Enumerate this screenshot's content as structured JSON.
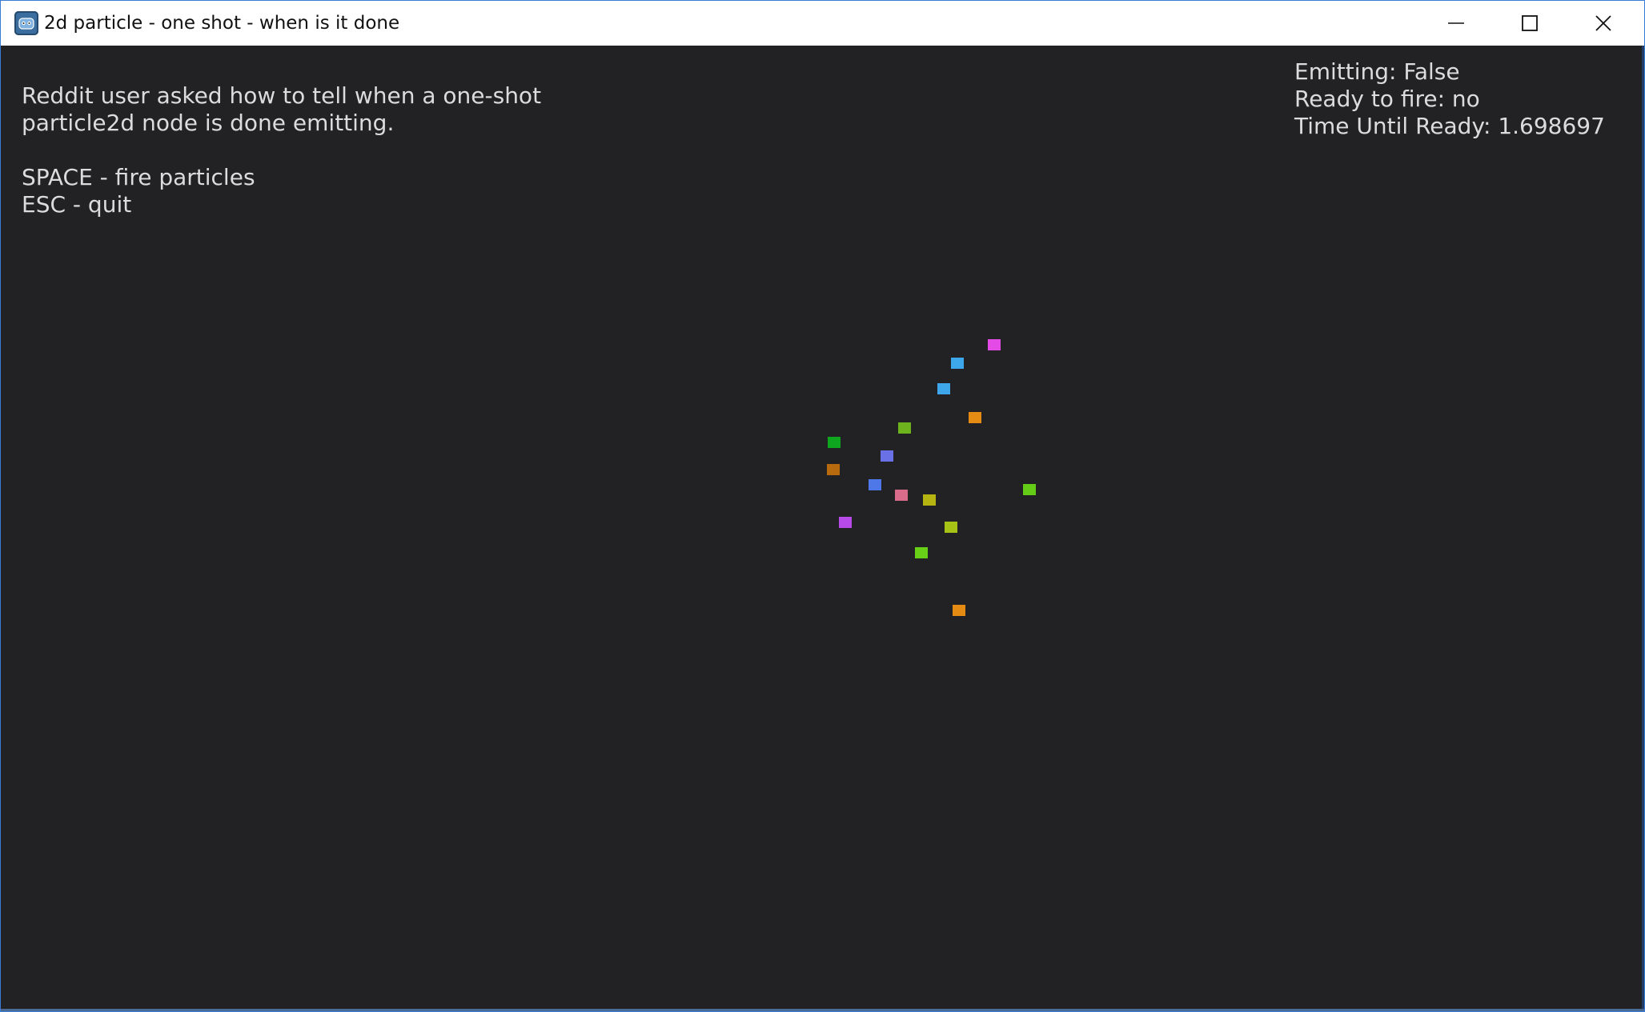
{
  "window": {
    "title": "2d particle - one shot - when is it done"
  },
  "icons": {
    "app": "godot-icon",
    "minimize": "minimize-icon",
    "maximize": "maximize-icon",
    "close": "close-icon"
  },
  "instructions": {
    "line1": "Reddit user asked how to tell when a one-shot",
    "line2": "particle2d node is done emitting.",
    "line3": "",
    "line4": "SPACE - fire particles",
    "line5": "ESC - quit"
  },
  "status": {
    "emitting": "Emitting: False",
    "ready": "Ready to fire: no",
    "time_until_ready": "Time Until Ready: 1.698697"
  },
  "particles": [
    {
      "color": "#e44be6"
    },
    {
      "color": "#3ea6ea"
    },
    {
      "color": "#3ea6ea"
    },
    {
      "color": "#e58a12"
    },
    {
      "color": "#6db31e"
    },
    {
      "color": "#0ea61f"
    },
    {
      "color": "#6a71e6"
    },
    {
      "color": "#b86a0e"
    },
    {
      "color": "#4e78e8"
    },
    {
      "color": "#d86c8a"
    },
    {
      "color": "#b5b411"
    },
    {
      "color": "#64cc16"
    },
    {
      "color": "#b74ae8"
    },
    {
      "color": "#a6c214"
    },
    {
      "color": "#68d016"
    },
    {
      "color": "#e58a12"
    }
  ]
}
